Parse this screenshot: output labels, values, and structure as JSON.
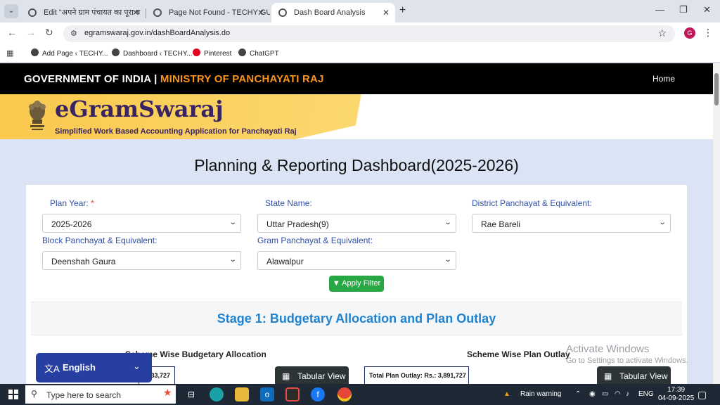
{
  "browser": {
    "tabs": [
      {
        "title": "Edit “अपने ग्राम पंचायत का पूरा ब",
        "active": false
      },
      {
        "title": "Page Not Found - TECHY GULS",
        "active": false
      },
      {
        "title": "Dash Board Analysis",
        "active": true
      }
    ],
    "url": "egramswaraj.gov.in/dashBoardAnalysis.do",
    "profile_initial": "G",
    "bookmarks": [
      {
        "label": "Add Page ‹ TECHY...",
        "icon": "wordpress-icon"
      },
      {
        "label": "Dashboard ‹ TECHY...",
        "icon": "wordpress-icon"
      },
      {
        "label": "Pinterest",
        "icon": "pinterest-icon"
      },
      {
        "label": "ChatGPT",
        "icon": "chatgpt-icon"
      }
    ]
  },
  "site": {
    "gov_label": "GOVERNMENT OF INDIA |",
    "ministry_label": "MINISTRY OF PANCHAYATI RAJ",
    "home_link": "Home",
    "brand": "eGramSwaraj",
    "tagline": "Simplified Work Based Accounting Application for Panchayati Raj"
  },
  "dashboard": {
    "title": "Planning & Reporting Dashboard(2025-2026)",
    "filters": {
      "plan_year": {
        "label": "Plan Year:",
        "required_mark": "*",
        "value": "2025-2026"
      },
      "state": {
        "label": "State Name:",
        "value": "Uttar Pradesh(9)"
      },
      "district": {
        "label": "District Panchayat & Equivalent:",
        "value": "Rae Bareli"
      },
      "block": {
        "label": "Block Panchayat & Equivalent:",
        "value": "Deenshah Gaura"
      },
      "gram": {
        "label": "Gram Panchayat & Equivalent:",
        "value": "Alawalpur"
      }
    },
    "apply_filter": "Apply Filter",
    "stage_title": "Stage 1: Budgetary Allocation and Plan Outlay",
    "budget_heading": "Scheme Wise Budgetary Allocation",
    "budget_value_partial": "33,727",
    "outlay_heading": "Scheme Wise Plan Outlay",
    "outlay_total": "Total Plan Outlay: Rs.: 3,891,727",
    "tabular_view": "Tabular View"
  },
  "language_widget": {
    "label": "English"
  },
  "watermark": {
    "line1": "Activate Windows",
    "line2": "Go to Settings to activate Windows."
  },
  "taskbar": {
    "search_placeholder": "Type here to search",
    "weather": "Rain warning",
    "lang": "ENG",
    "time": "17:39",
    "date": "04-09-2025"
  },
  "colors": {
    "ministry": "#f7941d",
    "brand": "#3a2361",
    "stage_title": "#1f83cf",
    "apply_filter": "#27a844",
    "language_widget": "#263fa0"
  }
}
